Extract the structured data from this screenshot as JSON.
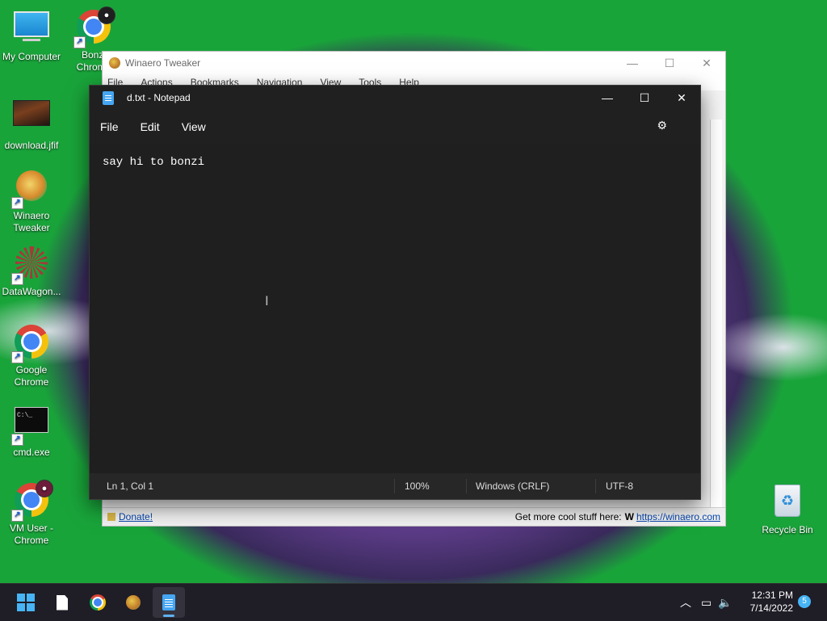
{
  "desktop": {
    "icons": [
      {
        "label": "My Computer"
      },
      {
        "label": "Bonzi\nChrome"
      },
      {
        "label": "download.jfif"
      },
      {
        "label": "Winaero\nTweaker"
      },
      {
        "label": "DataWagon..."
      },
      {
        "label": "Google\nChrome"
      },
      {
        "label": "cmd.exe"
      },
      {
        "label": "VM User -\nChrome"
      },
      {
        "label": "Recycle Bin"
      }
    ]
  },
  "winaero": {
    "title": "Winaero Tweaker",
    "menu": [
      "File",
      "Actions",
      "Bookmarks",
      "Navigation",
      "View",
      "Tools",
      "Help"
    ],
    "status_donate": "Donate!",
    "status_more": "Get more cool stuff here:",
    "status_link": "https://winaero.com"
  },
  "notepad": {
    "title": "d.txt - Notepad",
    "menu": [
      "File",
      "Edit",
      "View"
    ],
    "content": "say hi to bonzi",
    "status": {
      "position": "Ln 1, Col 1",
      "zoom": "100%",
      "line_ending": "Windows (CRLF)",
      "encoding": "UTF-8"
    }
  },
  "taskbar": {
    "time": "12:31 PM",
    "date": "7/14/2022",
    "notification_count": "5"
  },
  "colors": {
    "accent": "#47b4f5",
    "notepad_bg": "#1f1f1f"
  }
}
